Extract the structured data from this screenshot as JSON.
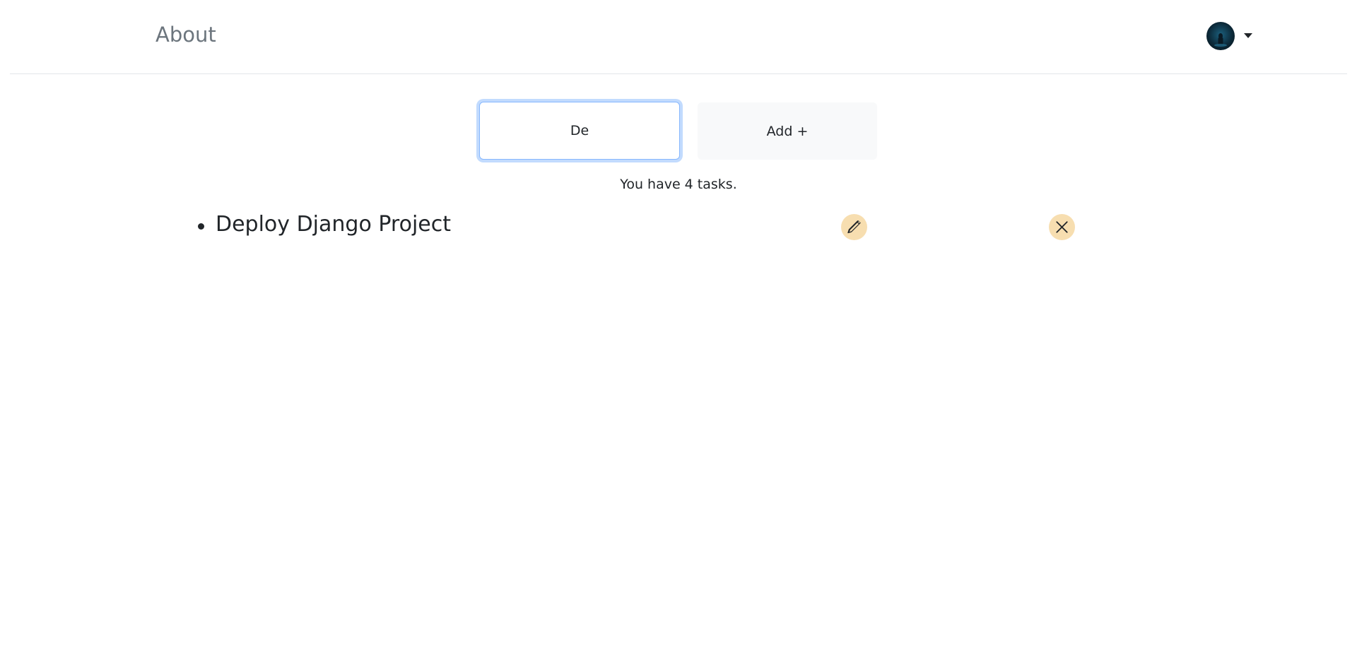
{
  "nav": {
    "about_label": "About"
  },
  "user_menu": {
    "avatar_icon": "user-avatar",
    "caret_icon": "caret-down-icon"
  },
  "form": {
    "task_input_value": "De",
    "add_button_label": "Add +"
  },
  "summary": {
    "task_count_text": "You have 4 tasks."
  },
  "tasks": [
    {
      "title": "Deploy Django Project",
      "edit_icon": "pencil-icon",
      "delete_icon": "close-icon"
    }
  ],
  "colors": {
    "action_icon_bg": "#f7deb0",
    "nav_link": "#6c757d",
    "focus_border": "#86b7fe",
    "add_button_bg": "#f8f9fa"
  }
}
